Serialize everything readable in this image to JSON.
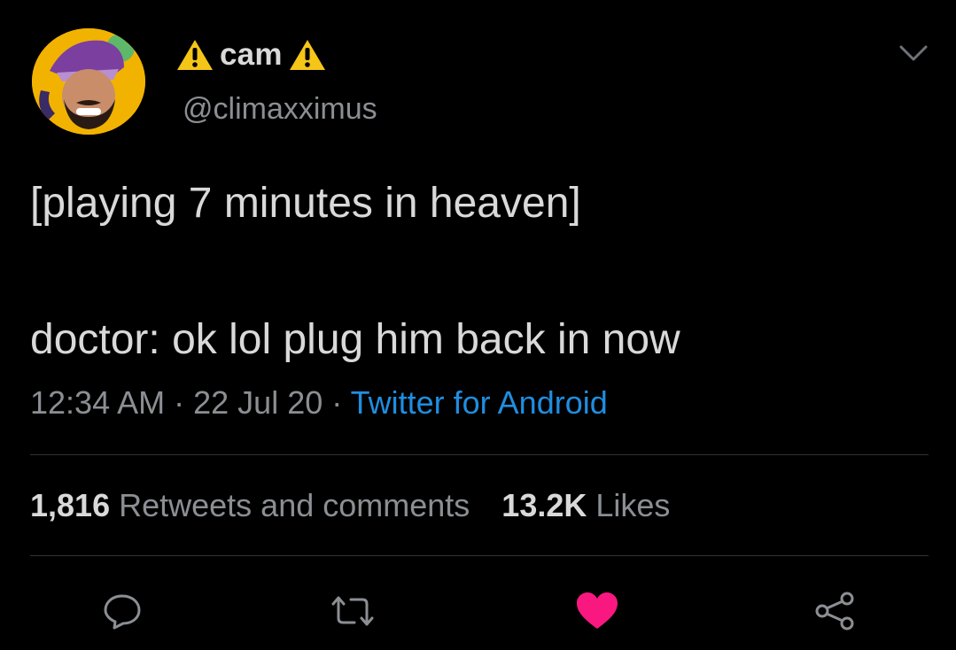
{
  "author": {
    "display_name": "cam",
    "handle": "@climaxximus",
    "badge_icons": [
      "warning-icon",
      "warning-icon"
    ]
  },
  "tweet": {
    "line1": "[playing 7 minutes in heaven]",
    "line2": "doctor: ok lol plug him back in now"
  },
  "meta": {
    "time": "12:34 AM",
    "separator": "·",
    "date": "22 Jul 20",
    "source": "Twitter for Android"
  },
  "stats": {
    "retweets_count": "1,816",
    "retweets_label": "Retweets and comments",
    "likes_count": "13.2K",
    "likes_label": "Likes"
  },
  "actions": [
    "reply-icon",
    "retweet-icon",
    "heart-icon",
    "share-icon"
  ],
  "colors": {
    "background": "#000000",
    "text": "#d9d9d9",
    "muted": "#8b8f93",
    "link": "#1f8ee0",
    "like": "#f91880",
    "warning": "#f5c518"
  }
}
